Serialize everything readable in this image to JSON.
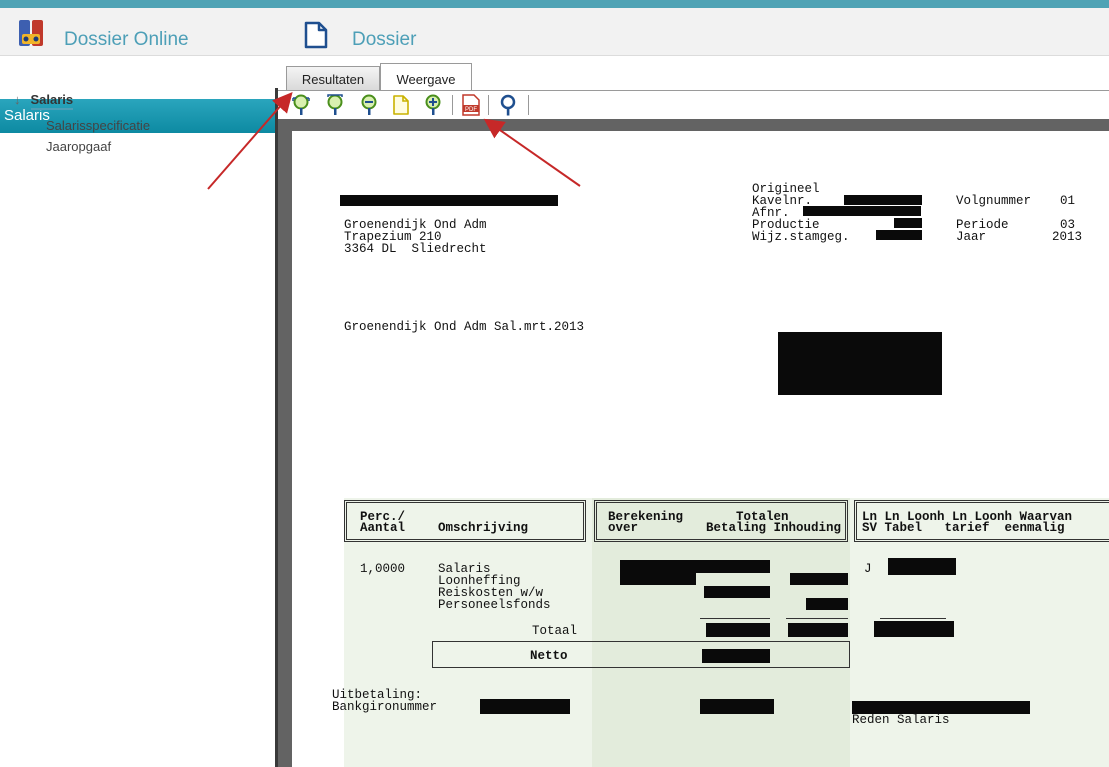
{
  "header": {
    "app_title": "Dossier Online",
    "section_title": "Dossier"
  },
  "sidebar": {
    "heading": "Salaris",
    "root_label": "Salaris",
    "items": [
      {
        "label": "Salarisspecificatie"
      },
      {
        "label": "Jaaropgaaf"
      }
    ]
  },
  "tabs": [
    {
      "label": "Resultaten",
      "active": false
    },
    {
      "label": "Weergave",
      "active": true
    }
  ],
  "toolbar": {
    "buttons": [
      "zoom-fit-icon",
      "zoom-in-icon",
      "zoom-out-icon",
      "page-icon",
      "zoom-plus-icon",
      "pdf-icon",
      "search-icon"
    ],
    "pdf_label": "PDF"
  },
  "document": {
    "meta_labels": [
      "Origineel",
      "Kavelnr.",
      "Afnr.",
      "Productie",
      "Wijz.stamgeg."
    ],
    "meta_right": [
      {
        "label": "Volgnummer",
        "value": "01"
      },
      {
        "label": "Periode",
        "value": "03"
      },
      {
        "label": "Jaar",
        "value": "2013"
      }
    ],
    "sender": [
      "Groenendijk Ond Adm",
      "Trapezium 210",
      "3364 DL  Sliedrecht"
    ],
    "subject": "Groenendijk Ond Adm Sal.mrt.2013",
    "table_headers": {
      "perc_line1": "Perc./",
      "perc_line2": "Aantal",
      "omschrijving": "Omschrijving",
      "berekening_line1": "Berekening",
      "berekening_line2": "over",
      "totalen": "Totalen",
      "betaling_inhouding": "Betaling Inhouding",
      "ln_group_line1": "Ln Ln Loonh Ln Loonh Waarvan",
      "ln_group_line2": "SV Tabel   tarief  eenmalig"
    },
    "rows": [
      {
        "aantal": "1,0000",
        "omschrijving": "Salaris"
      },
      {
        "aantal": "",
        "omschrijving": "Loonheffing"
      },
      {
        "aantal": "",
        "omschrijving": "Reiskosten w/w"
      },
      {
        "aantal": "",
        "omschrijving": "Personeelsfonds"
      }
    ],
    "ln_sv_value": "J",
    "totaal_label": "Totaal",
    "netto_label": "Netto",
    "uitbetaling_label": "Uitbetaling:",
    "bankgiro_label": "Bankgironummer",
    "reden_label": "Reden Salaris"
  }
}
